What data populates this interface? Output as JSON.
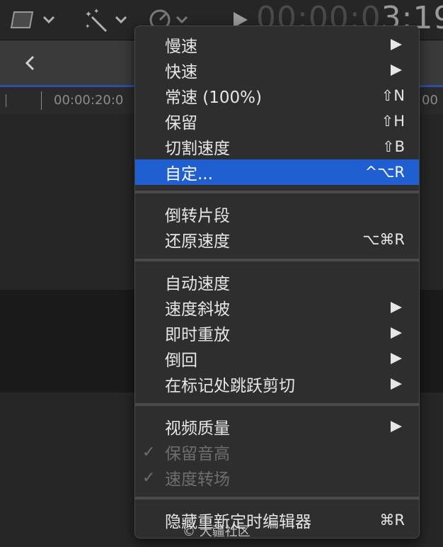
{
  "toolbar": {
    "timecode_dim": "00:00:0",
    "timecode_lit": "3:19"
  },
  "ruler": {
    "label_left": "00:00:20:0",
    "label_right": "00"
  },
  "menu": {
    "items": [
      {
        "label": "慢速",
        "shortcut": "",
        "submenu": true
      },
      {
        "label": "快速",
        "shortcut": "",
        "submenu": true
      },
      {
        "label": "常速 (100%)",
        "shortcut": "⇧N",
        "submenu": false
      },
      {
        "label": "保留",
        "shortcut": "⇧H",
        "submenu": false
      },
      {
        "label": "切割速度",
        "shortcut": "⇧B",
        "submenu": false
      },
      {
        "label": "自定...",
        "shortcut": "^⌥R",
        "submenu": false,
        "selected": true
      },
      {
        "label": "倒转片段",
        "shortcut": "",
        "submenu": false
      },
      {
        "label": "还原速度",
        "shortcut": "⌥⌘R",
        "submenu": false
      },
      {
        "label": "自动速度",
        "shortcut": "",
        "submenu": false
      },
      {
        "label": "速度斜坡",
        "shortcut": "",
        "submenu": true
      },
      {
        "label": "即时重放",
        "shortcut": "",
        "submenu": true
      },
      {
        "label": "倒回",
        "shortcut": "",
        "submenu": true
      },
      {
        "label": "在标记处跳跃剪切",
        "shortcut": "",
        "submenu": true
      },
      {
        "label": "视频质量",
        "shortcut": "",
        "submenu": true
      },
      {
        "label": "保留音高",
        "shortcut": "",
        "submenu": false,
        "checked": true,
        "disabled": true
      },
      {
        "label": "速度转场",
        "shortcut": "",
        "submenu": false,
        "checked": true,
        "disabled": true
      },
      {
        "label": "隐藏重新定时编辑器",
        "shortcut": "⌘R",
        "submenu": false
      }
    ],
    "check_glyph": "✓"
  },
  "watermark": "© 大疆社区",
  "colors": {
    "selection": "#1f5fd1",
    "menu_bg": "#2e2e2e",
    "text": "#e6e6e6",
    "disabled_text": "#6e6e6e"
  },
  "icons": {
    "crop": "crop-icon",
    "enhance": "magic-wand-icon",
    "retime": "speedometer-icon",
    "play": "play-icon",
    "back": "chevron-left-icon",
    "submenu": "chevron-right-icon"
  }
}
